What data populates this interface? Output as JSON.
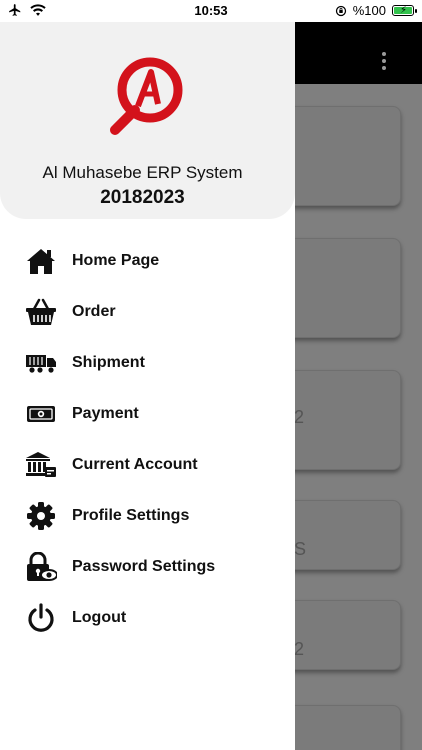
{
  "status_bar": {
    "time": "10:53",
    "battery_text": "%100",
    "battery_color": "#33c24d",
    "icons": [
      "airplane-icon",
      "wifi-icon",
      "orientation-lock-icon",
      "battery-icon"
    ]
  },
  "background": {
    "card_fragments": [
      "",
      "",
      "2",
      "S",
      "2",
      ""
    ]
  },
  "drawer": {
    "header": {
      "logo_name": "al-muhasebe-logo",
      "title": "Al Muhasebe ERP System",
      "year": "20182023",
      "logo_color": "#d3121b"
    },
    "menu": [
      {
        "label": "Home Page",
        "icon": "home-icon"
      },
      {
        "label": "Order",
        "icon": "basket-icon"
      },
      {
        "label": "Shipment",
        "icon": "truck-icon"
      },
      {
        "label": "Payment",
        "icon": "money-icon"
      },
      {
        "label": "Current Account",
        "icon": "bank-icon"
      },
      {
        "label": "Profile Settings",
        "icon": "gear-icon"
      },
      {
        "label": "Password Settings",
        "icon": "lock-eye-icon"
      },
      {
        "label": "Logout",
        "icon": "power-icon"
      }
    ]
  }
}
